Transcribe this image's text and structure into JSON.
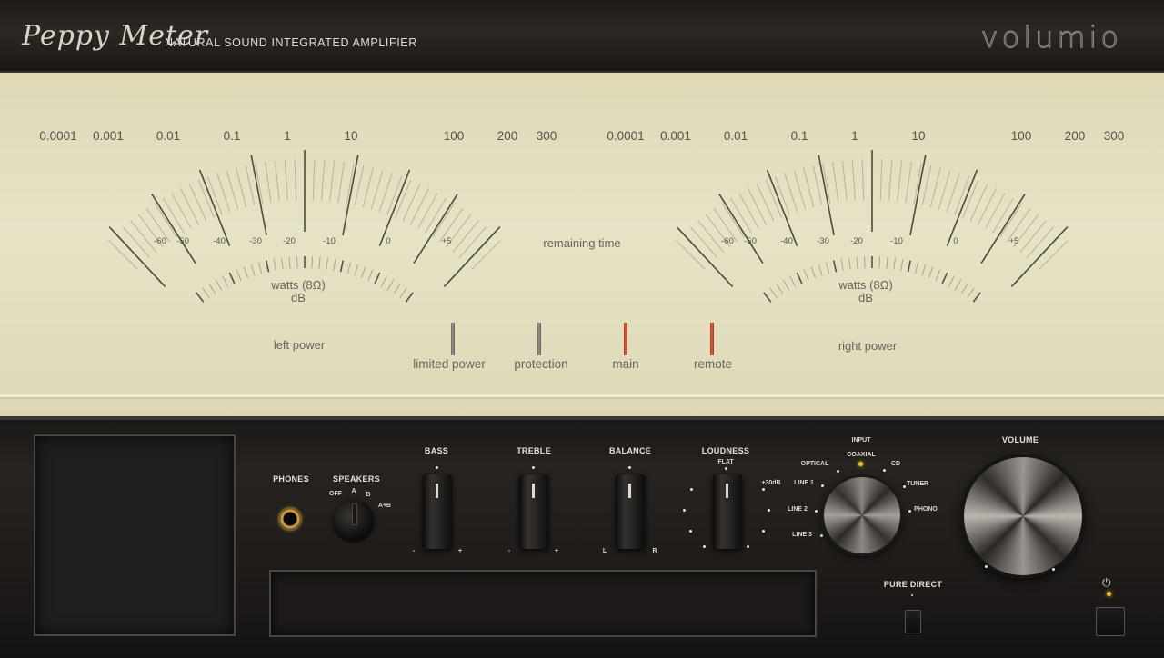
{
  "header": {
    "brand": "Peppy Meter",
    "subtitle": "NATURAL SOUND INTEGRATED AMPLIFIER",
    "logo": "volumio"
  },
  "meters": {
    "watts_scale": [
      "0.0001",
      "0.001",
      "0.01",
      "0.1",
      "1",
      "10",
      "100",
      "200",
      "300"
    ],
    "db_scale": [
      "-60",
      "-50",
      "-40",
      "-30",
      "-20",
      "-10",
      "0",
      "+5"
    ],
    "unit_watts": "watts (8Ω)",
    "unit_db": "dB",
    "center_label": "remaining time",
    "left_label": "left power",
    "right_label": "right power"
  },
  "indicators": [
    {
      "label": "limited power",
      "state": "off",
      "color": "#8a8680"
    },
    {
      "label": "protection",
      "state": "off",
      "color": "#8a8680"
    },
    {
      "label": "main",
      "state": "on",
      "color": "#d4552f"
    },
    {
      "label": "remote",
      "state": "on",
      "color": "#d4552f"
    }
  ],
  "controls": {
    "phones": "PHONES",
    "speakers": {
      "label": "SPEAKERS",
      "positions": [
        "OFF",
        "A",
        "B",
        "A+B"
      ]
    },
    "bass": {
      "label": "BASS",
      "min": "-",
      "max": "+"
    },
    "treble": {
      "label": "TREBLE",
      "min": "-",
      "max": "+"
    },
    "balance": {
      "label": "BALANCE",
      "min": "L",
      "max": "R"
    },
    "loudness": {
      "label": "LOUDNESS",
      "top": "FLAT",
      "right": "+30dB"
    },
    "input": {
      "label": "INPUT",
      "options": [
        "OPTICAL",
        "COAXIAL",
        "CD",
        "LINE 1",
        "TUNER",
        "LINE 2",
        "PHONO",
        "LINE 3"
      ],
      "selected": "COAXIAL"
    },
    "volume": "VOLUME",
    "pure_direct": "PURE DIRECT",
    "power_icon": "power-icon"
  },
  "colors": {
    "indicator_on": "#d4552f",
    "indicator_off": "#8a8680",
    "led": "#f2c23a"
  }
}
